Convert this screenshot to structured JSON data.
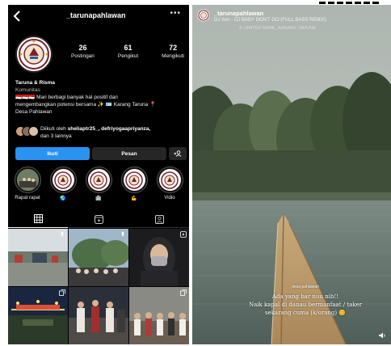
{
  "profile": {
    "username": "_tarunapahlawan",
    "stats": [
      {
        "value": "26",
        "label": "Postingan"
      },
      {
        "value": "61",
        "label": "Pengikut"
      },
      {
        "value": "72",
        "label": "Mengikuti"
      }
    ],
    "bio": {
      "name": "Taruna & Risma",
      "category": "Komunitas",
      "line1": "🇮🇩🇮🇩🇮🇩 Mari berbagi banyak hal positif dan",
      "line2": "mengembangkan potensi bersama ✨ 🪪 Karang Taruna 📍",
      "line3": "Desa Pahlawan"
    },
    "followed_by": {
      "prefix": "Diikuti oleh ",
      "names": "sheliaptr25_, defriyogaapriyanza,",
      "suffix": "dan 3 lainnya"
    },
    "buttons": {
      "follow": "Ikuti",
      "message": "Pesan",
      "add": "+&"
    },
    "highlights": [
      {
        "label": "Rapat rapat"
      },
      {
        "label": "🌏"
      },
      {
        "label": "🏥"
      },
      {
        "label": "💪"
      },
      {
        "label": "Vidio"
      }
    ]
  },
  "story": {
    "username": "_tarunapahlawan",
    "music": "DJ Xen - DJ BABY DON'T GO (FULL BASS REMIX)",
    "watermark": "© LIMITED NAME_KARANG TARUNA",
    "tag": "desa pahlawan",
    "caption_line1": "Ada yang bar nuu nih!!",
    "caption_line2": "Naik kapal di danau bermanfaat / taker",
    "caption_line3": "sekarang cuma (k/orang) 😊"
  },
  "colors": {
    "follow_button": "#2a92f0",
    "dark_button": "#262626",
    "background": "#000000"
  },
  "icons": {
    "back": "chevron-left-icon",
    "more": "more-icon",
    "grid": "grid-icon",
    "reels": "reels-icon",
    "tagged": "tagged-icon"
  }
}
